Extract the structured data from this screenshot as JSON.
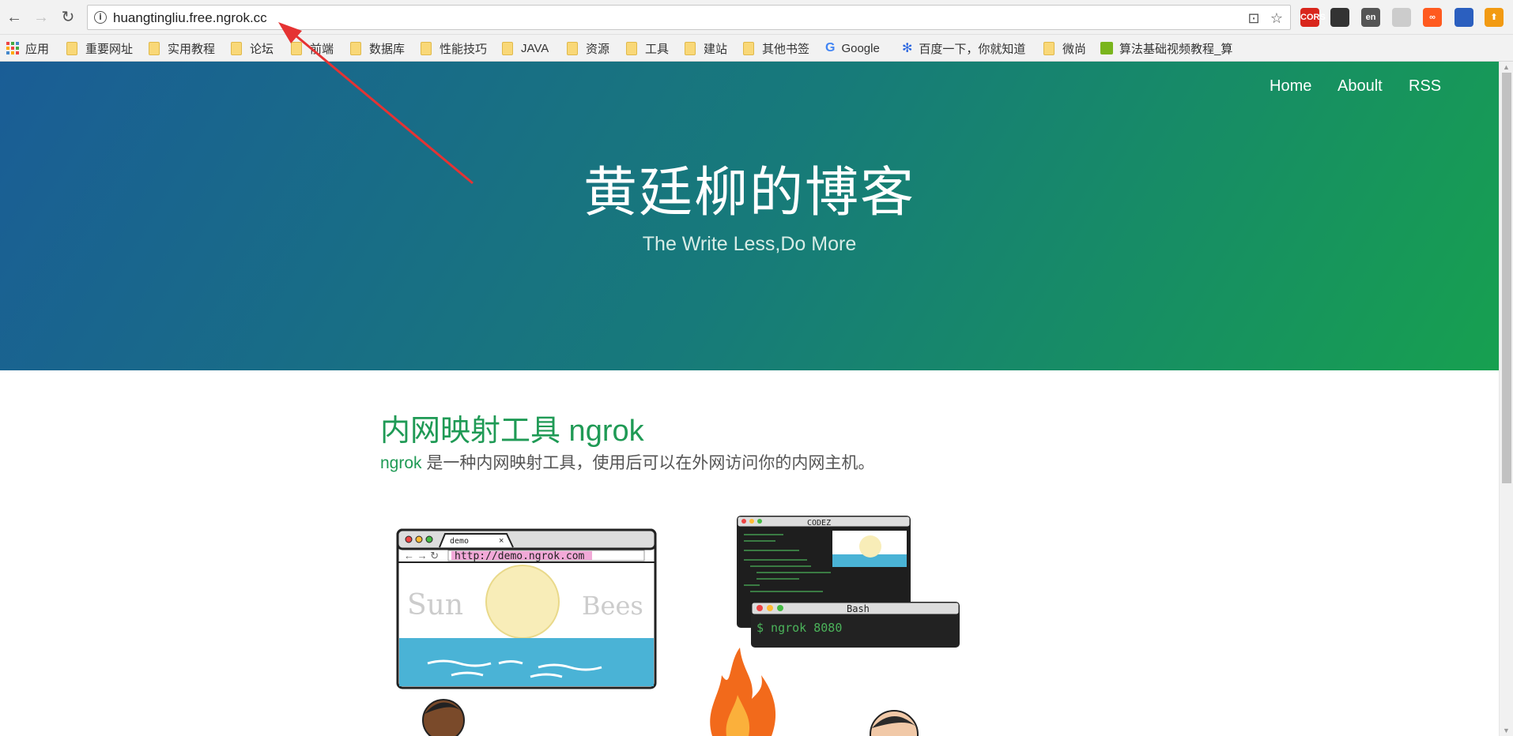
{
  "browser": {
    "url": "huangtingliu.free.ngrok.cc",
    "icons": {
      "back": "arrow-left-icon",
      "forward": "arrow-right-icon",
      "reload": "reload-icon",
      "info": "info-icon",
      "translate": "translate-icon",
      "star": "star-icon"
    },
    "extensions": [
      {
        "label": "CORS",
        "color": "#d9261c"
      },
      {
        "label": "",
        "color": "#333333",
        "icon": "evernote-icon"
      },
      {
        "label": "en",
        "color": "#555555",
        "icon": "translate-ext-icon"
      },
      {
        "label": "",
        "color": "#cccccc",
        "icon": "shield-icon"
      },
      {
        "label": "∞",
        "color": "#ff5a1f",
        "icon": "infinity-icon"
      },
      {
        "label": "",
        "color": "#2b5fbf",
        "icon": "calendar-icon"
      },
      {
        "label": "⬆",
        "color": "#f29a12",
        "icon": "upload-icon"
      }
    ]
  },
  "bookmarks": {
    "apps_label": "应用",
    "items": [
      {
        "label": "重要网址",
        "type": "folder"
      },
      {
        "label": "实用教程",
        "type": "folder"
      },
      {
        "label": "论坛",
        "type": "folder"
      },
      {
        "label": "前端",
        "type": "folder"
      },
      {
        "label": "数据库",
        "type": "folder"
      },
      {
        "label": "性能技巧",
        "type": "folder"
      },
      {
        "label": "JAVA",
        "type": "folder"
      },
      {
        "label": "资源",
        "type": "folder"
      },
      {
        "label": "工具",
        "type": "folder"
      },
      {
        "label": "建站",
        "type": "folder"
      },
      {
        "label": "其他书签",
        "type": "folder"
      },
      {
        "label": "Google",
        "type": "google"
      },
      {
        "label": "百度一下，你就知道",
        "type": "baidu"
      },
      {
        "label": "微尚",
        "type": "folder"
      },
      {
        "label": "算法基础视频教程_算",
        "type": "site"
      }
    ]
  },
  "site": {
    "menu": [
      "Home",
      "Aboult",
      "RSS"
    ],
    "title": "黄廷柳的博客",
    "subtitle": "The Write Less,Do More"
  },
  "post": {
    "title": "内网映射工具 ngrok",
    "desc_keyword": "ngrok",
    "desc_rest": " 是一种内网映射工具，使用后可以在外网访问你的内网主机。"
  },
  "illustration": {
    "browser_tab": "demo",
    "browser_url": "http://demo.ngrok.com",
    "brand_left": "Sun",
    "brand_right": "Bees",
    "editor_title": "CODEZ",
    "terminal_title": "Bash",
    "terminal_cmd": "$ ngrok 8080"
  }
}
